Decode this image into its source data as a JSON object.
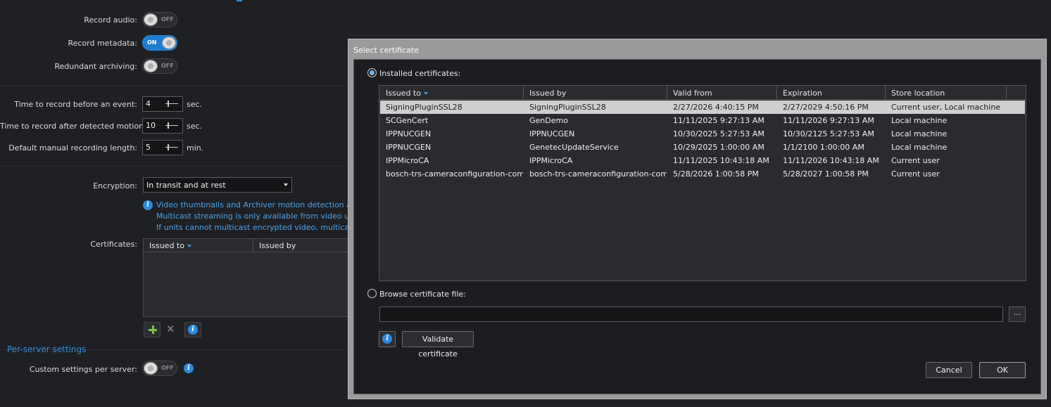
{
  "settings": {
    "record_audio": {
      "label": "Record audio:",
      "state": "OFF"
    },
    "record_metadata": {
      "label": "Record metadata:",
      "state": "ON"
    },
    "redundant_archiving": {
      "label": "Redundant archiving:",
      "state": "OFF"
    },
    "time_before_event": {
      "label": "Time to record before an event:",
      "value": "4",
      "unit": "sec."
    },
    "time_after_motion": {
      "label": "Time to record after detected motion:",
      "value": "10",
      "unit": "sec."
    },
    "manual_length": {
      "label": "Default manual recording length:",
      "value": "5",
      "unit": "min."
    },
    "encryption": {
      "label": "Encryption:",
      "value": "In transit and at rest"
    },
    "info_lines": [
      "Video thumbnails and Archiver motion detection are",
      "Multicast streaming is only available from video units",
      "If units cannot multicast encrypted video, multicast s"
    ],
    "certificates": {
      "label": "Certificates:",
      "col_issued_to": "Issued to",
      "col_issued_by": "Issued by"
    },
    "per_server_title": "Per-server settings",
    "custom_per_server": {
      "label": "Custom settings per server:",
      "state": "OFF"
    }
  },
  "dialog": {
    "title": "Select certificate",
    "installed_label": "Installed certificates:",
    "browse_label": "Browse certificate file:",
    "browse_button": "...",
    "validate_button": "Validate certificate",
    "cancel_button": "Cancel",
    "ok_button": "OK",
    "columns": [
      "Issued to",
      "Issued by",
      "Valid from",
      "Expiration",
      "Store location"
    ],
    "rows": [
      [
        "SigningPluginSSL28",
        "SigningPluginSSL28",
        "2/27/2026 4:40:15 PM",
        "2/27/2029 4:50:16 PM",
        "Current user, Local machine"
      ],
      [
        "SCGenCert",
        "GenDemo",
        "11/11/2025 9:27:13 AM",
        "11/11/2026 9:27:13 AM",
        "Local machine"
      ],
      [
        "IPPNUCGEN",
        "IPPNUCGEN",
        "10/30/2025 5:27:53 AM",
        "10/30/2125 5:27:53 AM",
        "Local machine"
      ],
      [
        "IPPNUCGEN",
        "GenetecUpdateService",
        "10/29/2025 1:00:00 AM",
        "1/1/2100 1:00:00 AM",
        "Local machine"
      ],
      [
        "IPPMicroCA",
        "IPPMicroCA",
        "11/11/2025 10:43:18 AM",
        "11/11/2026 10:43:18 AM",
        "Current user"
      ],
      [
        "bosch-trs-cameraconfiguration-comn",
        "bosch-trs-cameraconfiguration-comn",
        "5/28/2026 1:00:58 PM",
        "5/28/2027 1:00:58 PM",
        "Current user"
      ]
    ]
  },
  "colors": {
    "accent": "#2a8ae0",
    "background": "#1f2023",
    "dialog_frame": "#9a9a9a",
    "selected_row": "#cfcfcf",
    "add_icon": "#7cc242"
  }
}
